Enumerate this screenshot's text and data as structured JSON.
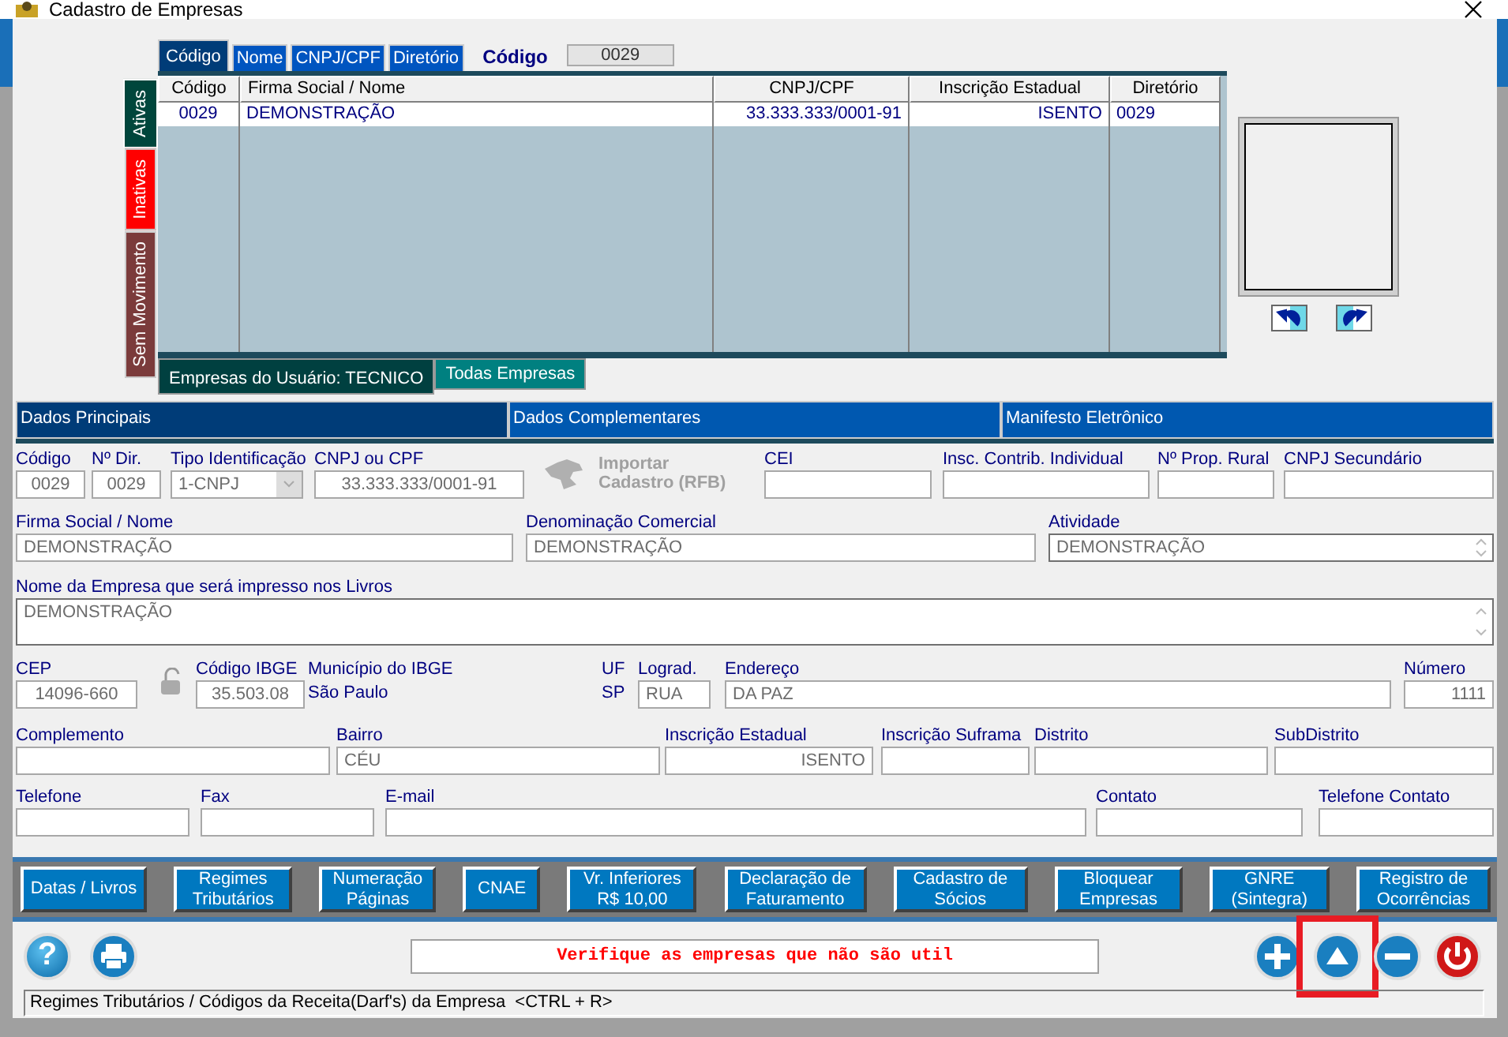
{
  "window": {
    "title": "Cadastro de Empresas"
  },
  "search": {
    "tabs": [
      {
        "label": "Código",
        "selected": true
      },
      {
        "label": "Nome",
        "selected": false
      },
      {
        "label": "CNPJ/CPF",
        "selected": false
      },
      {
        "label": "Diretório",
        "selected": false
      }
    ],
    "label": "Código",
    "value": "0029"
  },
  "status_tabs": [
    {
      "label": "Ativas",
      "selected": true,
      "color": "#00463c"
    },
    {
      "label": "Inativas",
      "selected": false,
      "color": "#ff0000"
    },
    {
      "label": "Sem Movimento",
      "selected": false,
      "color": "#7b3b3b"
    }
  ],
  "table": {
    "columns": [
      "Código",
      "Firma Social / Nome",
      "CNPJ/CPF",
      "Inscrição Estadual",
      "Diretório"
    ],
    "rows": [
      [
        "0029",
        "DEMONSTRAÇÃO",
        "33.333.333/0001-91",
        "ISENTO",
        "0029"
      ]
    ]
  },
  "scope_tabs": [
    {
      "label": "Empresas do Usuário: TECNICO",
      "selected": true
    },
    {
      "label": "Todas Empresas",
      "selected": false
    }
  ],
  "detail_tabs": [
    {
      "label": "Dados Principais",
      "selected": true
    },
    {
      "label": "Dados Complementares",
      "selected": false
    },
    {
      "label": "Manifesto Eletrônico",
      "selected": false
    }
  ],
  "form": {
    "lines": [
      {
        "fields": [
          {
            "kind": "field",
            "label": "Código",
            "value": "0029"
          },
          {
            "kind": "field",
            "label": "Nº Dir.",
            "value": "0029"
          },
          {
            "kind": "select",
            "label": "Tipo Identificação",
            "value": "1-CNPJ"
          },
          {
            "kind": "field",
            "label": "CNPJ ou CPF",
            "value": "33.333.333/0001-91"
          },
          {
            "kind": "import",
            "label": "Importar\nCadastro (RFB)",
            "disabled": true
          },
          {
            "kind": "field",
            "label": "CEI"
          },
          {
            "kind": "field",
            "label": "Insc. Contrib. Individual"
          },
          {
            "kind": "field",
            "label": "Nº Prop. Rural"
          },
          {
            "kind": "field",
            "label": "CNPJ Secundário"
          }
        ]
      },
      {
        "fields": [
          {
            "kind": "field",
            "label": "Firma Social / Nome",
            "value": "DEMONSTRAÇÃO"
          },
          {
            "kind": "field",
            "label": "Denominação Comercial",
            "value": "DEMONSTRAÇÃO"
          },
          {
            "kind": "spinner",
            "label": "Atividade",
            "value": "DEMONSTRAÇÃO"
          }
        ]
      },
      {
        "fields": [
          {
            "kind": "textarea",
            "label": "Nome da Empresa que será impresso nos Livros",
            "value": "DEMONSTRAÇÃO"
          }
        ]
      },
      {
        "fields": [
          {
            "kind": "field",
            "label": "CEP",
            "value": "14096-660"
          },
          {
            "kind": "lock"
          },
          {
            "kind": "field",
            "label": "Código IBGE",
            "value": "35.503.08"
          },
          {
            "kind": "info",
            "label": "Município do IBGE",
            "value": "São Paulo"
          },
          {
            "kind": "info",
            "label": "UF",
            "value": "SP"
          },
          {
            "kind": "field",
            "label": "Lograd.",
            "value": "RUA"
          },
          {
            "kind": "field",
            "label": "Endereço",
            "value": "DA PAZ"
          },
          {
            "kind": "field",
            "label": "Número",
            "value": "1111"
          }
        ]
      },
      {
        "fields": [
          {
            "kind": "field",
            "label": "Complemento"
          },
          {
            "kind": "field",
            "label": "Bairro",
            "value": "CÉU"
          },
          {
            "kind": "field",
            "label": "Inscrição Estadual",
            "value": "ISENTO"
          },
          {
            "kind": "field",
            "label": "Inscrição Suframa"
          },
          {
            "kind": "field",
            "label": "Distrito"
          },
          {
            "kind": "field",
            "label": "SubDistrito"
          }
        ]
      },
      {
        "fields": [
          {
            "kind": "field",
            "label": "Telefone"
          },
          {
            "kind": "field",
            "label": "Fax"
          },
          {
            "kind": "field",
            "label": "E-mail"
          },
          {
            "kind": "field",
            "label": "Contato"
          },
          {
            "kind": "field",
            "label": "Telefone Contato"
          }
        ]
      }
    ]
  },
  "function_buttons": [
    "Datas / Livros",
    "Regimes\nTributários",
    "Numeração\nPáginas",
    "CNAE",
    "Vr. Inferiores\nR$ 10,00",
    "Declaração de\nFaturamento",
    "Cadastro de\nSócios",
    "Bloquear\nEmpresas",
    "GNRE\n(Sintegra)",
    "Registro de\nOcorrências"
  ],
  "tools": [
    {
      "kind": "help",
      "label": "?"
    },
    {
      "kind": "print"
    }
  ],
  "message": {
    "text": "Verifique as empresas que não são util"
  },
  "actions": [
    {
      "kind": "add",
      "highlighted": false
    },
    {
      "kind": "up",
      "highlighted": true
    },
    {
      "kind": "remove",
      "highlighted": false
    },
    {
      "kind": "power",
      "highlighted": false
    }
  ],
  "status_bar": {
    "text": "Regimes Tributários / Códigos da Receita(Darf's) da Empresa  <CTRL + R>"
  }
}
